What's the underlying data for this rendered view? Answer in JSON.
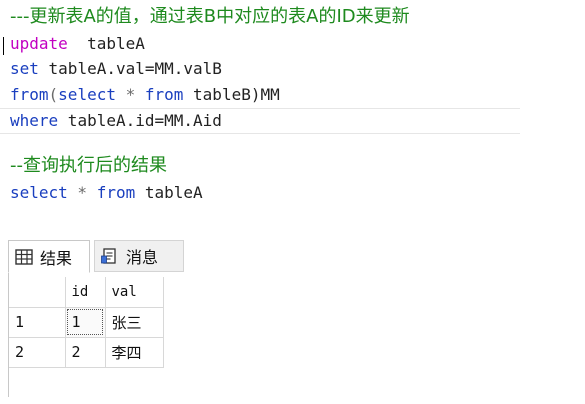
{
  "editor": {
    "comment1": "---更新表A的值，通过表B中对应的表A的ID来更新",
    "line_update_kw": "update",
    "line_update_ident": "  tableA",
    "line_set_kw": "set",
    "line_set_rest": " tableA.val=MM.valB",
    "line_from_kw": "from",
    "line_from_paren": "(",
    "line_from_select": "select",
    "line_from_star": " * ",
    "line_from_from": "from",
    "line_from_rest": " tableB)MM",
    "line_where_kw": "where",
    "line_where_rest": " tableA.id=MM.Aid",
    "comment2": "--查询执行后的结果",
    "line_q_select": "select",
    "line_q_star": " * ",
    "line_q_from": "from",
    "line_q_rest": " tableA"
  },
  "results": {
    "tabs": {
      "results_label": "结果",
      "messages_label": "消息",
      "results_icon": "grid-icon",
      "messages_icon": "messages-icon"
    },
    "columns": [
      "",
      "id",
      "val"
    ],
    "rows": [
      {
        "rownum": "1",
        "id": "1",
        "val": "张三"
      },
      {
        "rownum": "2",
        "id": "2",
        "val": "李四"
      }
    ]
  }
}
